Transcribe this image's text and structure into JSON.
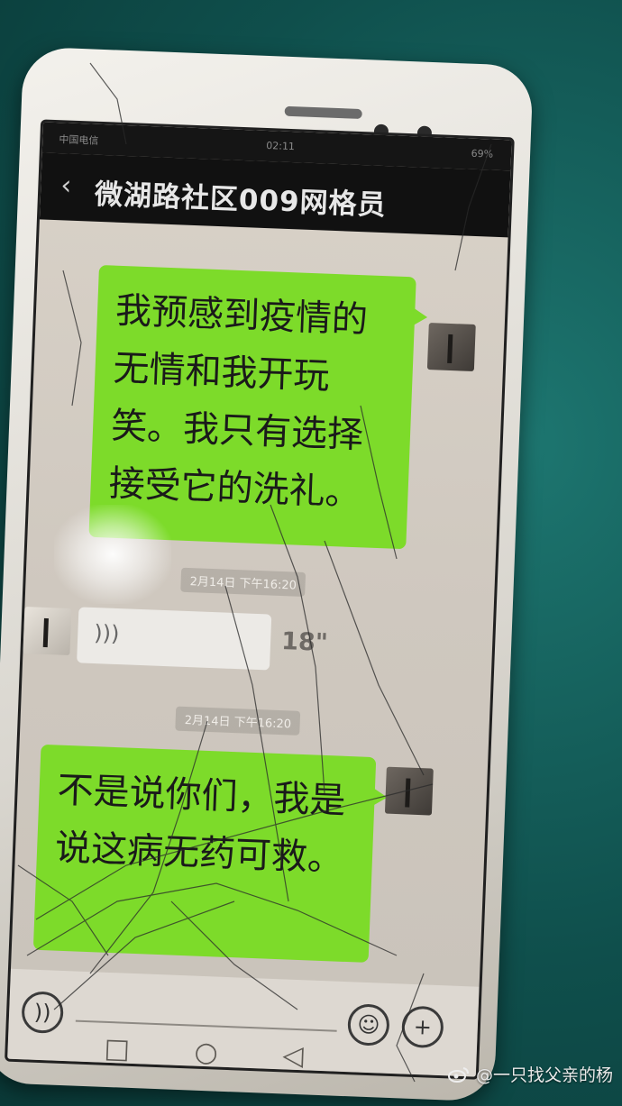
{
  "status_bar": {
    "carrier": "中国电信",
    "time": "02:11",
    "battery": "69%"
  },
  "chat": {
    "title": "微湖路社区009网格员",
    "back_icon": "chevron-left-icon"
  },
  "messages": [
    {
      "type": "text",
      "direction": "outgoing",
      "text": "我预感到疫情的无情和我开玩笑。我只有选择接受它的洗礼。"
    },
    {
      "type": "timestamp",
      "text": "2月14日 下午16:20"
    },
    {
      "type": "voice",
      "direction": "incoming",
      "duration": "18\""
    },
    {
      "type": "timestamp",
      "text": "2月14日 下午16:20"
    },
    {
      "type": "text",
      "direction": "outgoing",
      "text": "不是说你们，我是说这病无药可救。"
    }
  ],
  "input_bar": {
    "voice_icon": "voice-icon",
    "emoji_icon": "emoji-icon",
    "plus_icon": "plus-icon"
  },
  "nav_bar": {
    "back_icon": "triangle-back-icon",
    "home_icon": "circle-home-icon",
    "recent_icon": "square-recent-icon"
  },
  "watermark": {
    "text": "@一只找父亲的杨",
    "icon": "weibo-logo-icon"
  }
}
